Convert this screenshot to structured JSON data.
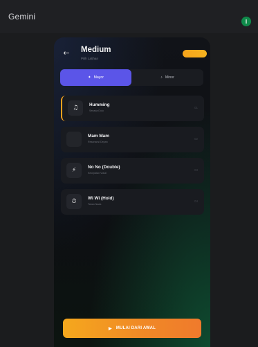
{
  "topbar": {
    "title": "Gemini",
    "avatar_initial": "I"
  },
  "header": {
    "back_icon": "arrow-left-icon",
    "title": "Medium",
    "subtitle": "Pilih Latihan"
  },
  "tabs": [
    {
      "label": "Mayor",
      "icon": "sparkle-icon",
      "selected": true
    },
    {
      "label": "Minor",
      "icon": "note-icon",
      "selected": false
    }
  ],
  "cards": [
    {
      "title": "Humming",
      "subtitle": "Senada Dulu",
      "num": "01",
      "icon": "music-note-icon",
      "icon_glyph": "♫",
      "active": true
    },
    {
      "title": "Mam Mam",
      "subtitle": "Resonansi Depan",
      "num": "02",
      "icon": "",
      "icon_glyph": "",
      "active": false
    },
    {
      "title": "No No (Double)",
      "subtitle": "Kecepatan Vokal",
      "num": "03",
      "icon": "lightning-icon",
      "icon_glyph": "⚡",
      "active": false
    },
    {
      "title": "Wi Wi (Hold)",
      "subtitle": "Tahan Nada",
      "num": "04",
      "icon": "timer-icon",
      "icon_glyph": "⏱",
      "active": false
    }
  ],
  "cta": {
    "label": "MULAI DARI AWAL",
    "icon": "play-icon"
  },
  "colors": {
    "accent_orange": "#f5a81d",
    "tab_purple": "#5b55e8",
    "avatar_green": "#0f8a4a"
  }
}
